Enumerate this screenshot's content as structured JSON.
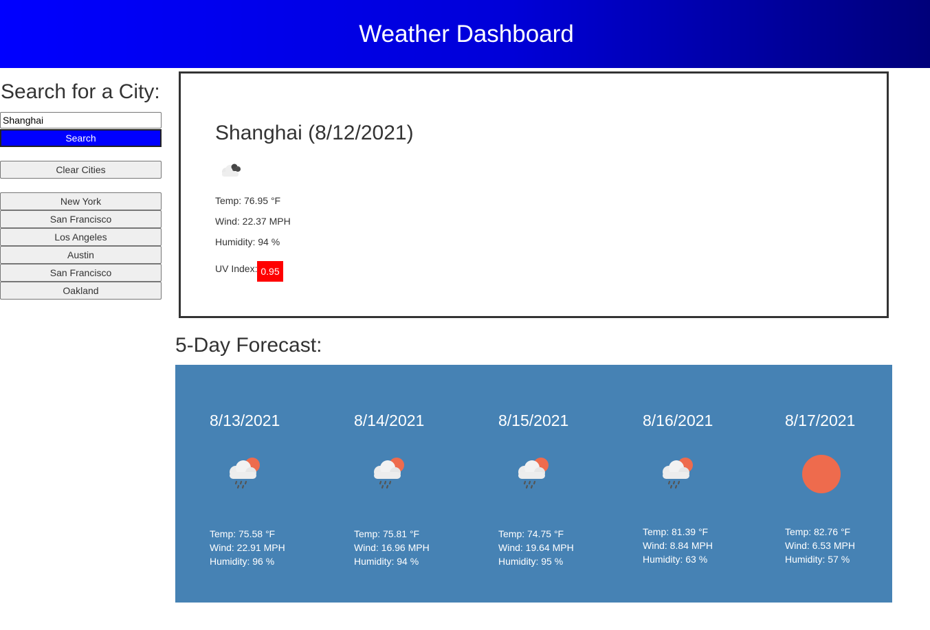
{
  "header": {
    "title": "Weather Dashboard"
  },
  "sidebar": {
    "heading": "Search for a City:",
    "search_value": "Shanghai",
    "search_label": "Search",
    "clear_label": "Clear Cities",
    "cities": [
      "New York",
      "San Francisco",
      "Los Angeles",
      "Austin",
      "San Francisco",
      "Oakland"
    ]
  },
  "current": {
    "title": "Shanghai (8/12/2021)",
    "icon": "broken-clouds-icon",
    "temp": "Temp: 76.95 °F",
    "wind": "Wind: 22.37 MPH",
    "humidity": "Humidity: 94 %",
    "uv_label": "UV Index:",
    "uv_value": "0.95",
    "uv_color": "#ff0000"
  },
  "forecast": {
    "heading": "5-Day Forecast:",
    "background": "#4682b4",
    "days": [
      {
        "date": "8/13/2021",
        "icon": "rain-sun-icon",
        "temp": "Temp: 75.58 °F",
        "wind": "Wind: 22.91 MPH",
        "humidity": "Humidity: 96 %"
      },
      {
        "date": "8/14/2021",
        "icon": "rain-sun-icon",
        "temp": "Temp: 75.81 °F",
        "wind": "Wind: 16.96 MPH",
        "humidity": "Humidity: 94 %"
      },
      {
        "date": "8/15/2021",
        "icon": "rain-sun-icon",
        "temp": "Temp: 74.75 °F",
        "wind": "Wind: 19.64 MPH",
        "humidity": "Humidity: 95 %"
      },
      {
        "date": "8/16/2021",
        "icon": "rain-sun-icon",
        "temp": "Temp: 81.39 °F",
        "wind": "Wind: 8.84 MPH",
        "humidity": "Humidity: 63 %"
      },
      {
        "date": "8/17/2021",
        "icon": "sun-icon",
        "temp": "Temp: 82.76 °F",
        "wind": "Wind: 6.53 MPH",
        "humidity": "Humidity: 57 %"
      }
    ]
  }
}
